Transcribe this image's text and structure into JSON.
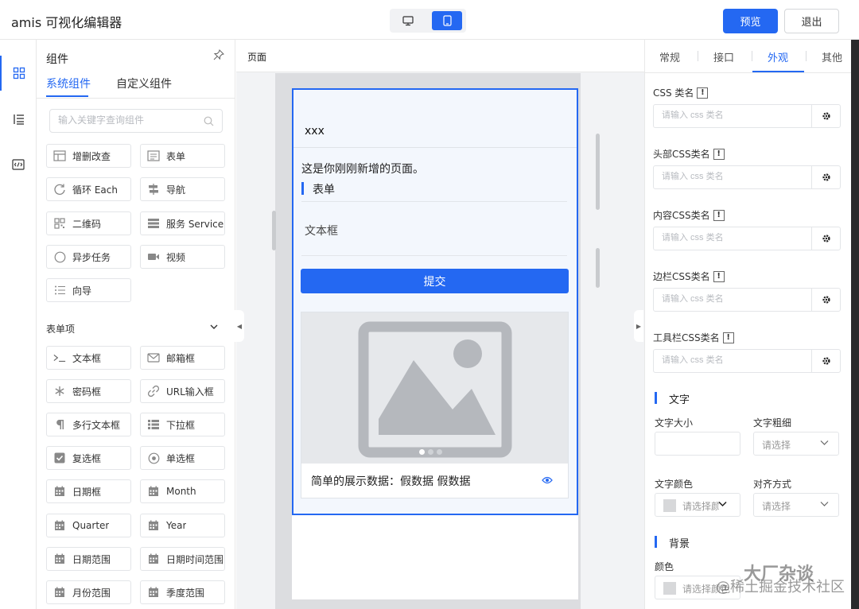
{
  "header": {
    "title": "amis 可视化编辑器",
    "preview_label": "预览",
    "exit_label": "退出"
  },
  "rail": {
    "items": [
      "component-icon",
      "outline-icon",
      "code-icon"
    ]
  },
  "components_panel": {
    "title": "组件",
    "tab_system": "系统组件",
    "tab_custom": "自定义组件",
    "search_placeholder": "输入关键字查询组件",
    "basic": [
      {
        "label": "增删改查",
        "icon": "table-icon"
      },
      {
        "label": "表单",
        "icon": "form-icon"
      },
      {
        "label": "循环 Each",
        "icon": "loop-icon"
      },
      {
        "label": "导航",
        "icon": "nav-icon"
      },
      {
        "label": "二维码",
        "icon": "qrcode-icon"
      },
      {
        "label": "服务 Service",
        "icon": "service-icon"
      },
      {
        "label": "异步任务",
        "icon": "circle-icon"
      },
      {
        "label": "视频",
        "icon": "video-icon"
      },
      {
        "label": "向导",
        "icon": "list-icon"
      }
    ],
    "form_items_title": "表单项",
    "form_items": [
      {
        "label": "文本框",
        "icon": "terminal-icon"
      },
      {
        "label": "邮箱框",
        "icon": "mail-icon"
      },
      {
        "label": "密码框",
        "icon": "asterisk-icon"
      },
      {
        "label": "URL输入框",
        "icon": "link-icon"
      },
      {
        "label": "多行文本框",
        "icon": "paragraph-icon"
      },
      {
        "label": "下拉框",
        "icon": "select-icon"
      },
      {
        "label": "复选框",
        "icon": "checkbox-icon"
      },
      {
        "label": "单选框",
        "icon": "radio-icon"
      },
      {
        "label": "日期框",
        "icon": "calendar-icon"
      },
      {
        "label": "Month",
        "icon": "calendar-icon"
      },
      {
        "label": "Quarter",
        "icon": "calendar-icon"
      },
      {
        "label": "Year",
        "icon": "calendar-icon"
      },
      {
        "label": "日期范围",
        "icon": "calendar-icon"
      },
      {
        "label": "日期时间范围",
        "icon": "calendar-icon"
      },
      {
        "label": "月份范围",
        "icon": "calendar-icon"
      },
      {
        "label": "季度范围",
        "icon": "calendar-icon"
      }
    ]
  },
  "canvas": {
    "header_label": "页面",
    "page_title": "xxx",
    "intro_text": "这是你刚刚新增的页面。",
    "form_title": "表单",
    "field_label": "文本框",
    "submit_label": "提交",
    "card_text": "简单的展示数据：假数据 假数据"
  },
  "config": {
    "tabs": [
      "常规",
      "接口",
      "外观",
      "其他"
    ],
    "active_tab": "外观",
    "css_fields": [
      {
        "label": "CSS 类名",
        "placeholder": "请输入 css 类名"
      },
      {
        "label": "头部CSS类名",
        "placeholder": "请输入 css 类名"
      },
      {
        "label": "内容CSS类名",
        "placeholder": "请输入 css 类名"
      },
      {
        "label": "边栏CSS类名",
        "placeholder": "请输入 css 类名"
      },
      {
        "label": "工具栏CSS类名",
        "placeholder": "请输入 css 类名"
      }
    ],
    "text_section": {
      "title": "文字",
      "font_size_label": "文字大小",
      "font_weight_label": "文字粗细",
      "font_weight_placeholder": "请选择",
      "color_label": "文字颜色",
      "color_placeholder": "请选择颜色",
      "align_label": "对齐方式",
      "align_placeholder": "请选择"
    },
    "bg_section": {
      "title": "背景",
      "color_label": "颜色",
      "color_placeholder": "请选择颜色"
    }
  },
  "watermark": {
    "line1": "大厂杂谈",
    "line2": "@稀土掘金技术社区"
  },
  "colors": {
    "accent": "#2468f2"
  }
}
